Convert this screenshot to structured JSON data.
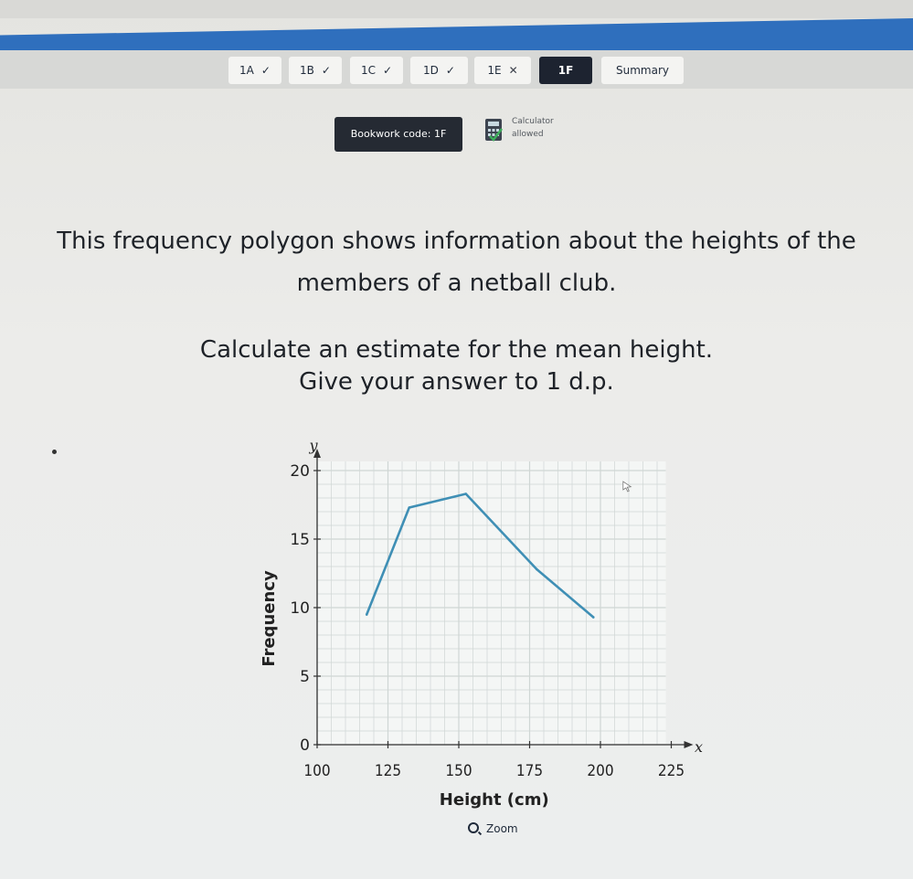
{
  "tabs": [
    {
      "label": "1A",
      "status": "✓",
      "state": "correct"
    },
    {
      "label": "1B",
      "status": "✓",
      "state": "correct"
    },
    {
      "label": "1C",
      "status": "✓",
      "state": "correct"
    },
    {
      "label": "1D",
      "status": "✓",
      "state": "correct"
    },
    {
      "label": "1E",
      "status": "✕",
      "state": "wrong"
    },
    {
      "label": "1F",
      "status": "",
      "state": "current"
    },
    {
      "label": "Summary",
      "status": "",
      "state": "summary"
    }
  ],
  "bookwork": {
    "label": "Bookwork code: 1F"
  },
  "calculator": {
    "line1": "Calculator",
    "line2": "allowed"
  },
  "question": {
    "line1": "This frequency polygon shows information about the heights of the",
    "line2": "members of a netball club.",
    "line3": "Calculate an estimate for the mean height.",
    "line4": "Give your answer to 1 d.p."
  },
  "zoom": {
    "label": "Zoom"
  },
  "colors": {
    "accent_blue": "#2f6fbd",
    "line": "#3f8fb5",
    "dark_tab": "#1d2330"
  },
  "chart_data": {
    "type": "line",
    "xlabel": "Height (cm)",
    "ylabel": "Frequency",
    "x_axis_symbol": "x",
    "y_axis_symbol": "y",
    "xlim": [
      100,
      225
    ],
    "ylim": [
      0,
      20
    ],
    "x_ticks": [
      "100",
      "125",
      "150",
      "175",
      "200",
      "225"
    ],
    "y_ticks": [
      "0",
      "5",
      "10",
      "15",
      "20"
    ],
    "grid": true,
    "series": [
      {
        "x": [
          117.5,
          132.5,
          152.5,
          177.5,
          197.5
        ],
        "y": [
          9.5,
          17.3,
          18.3,
          12.8,
          9.3
        ]
      }
    ]
  }
}
